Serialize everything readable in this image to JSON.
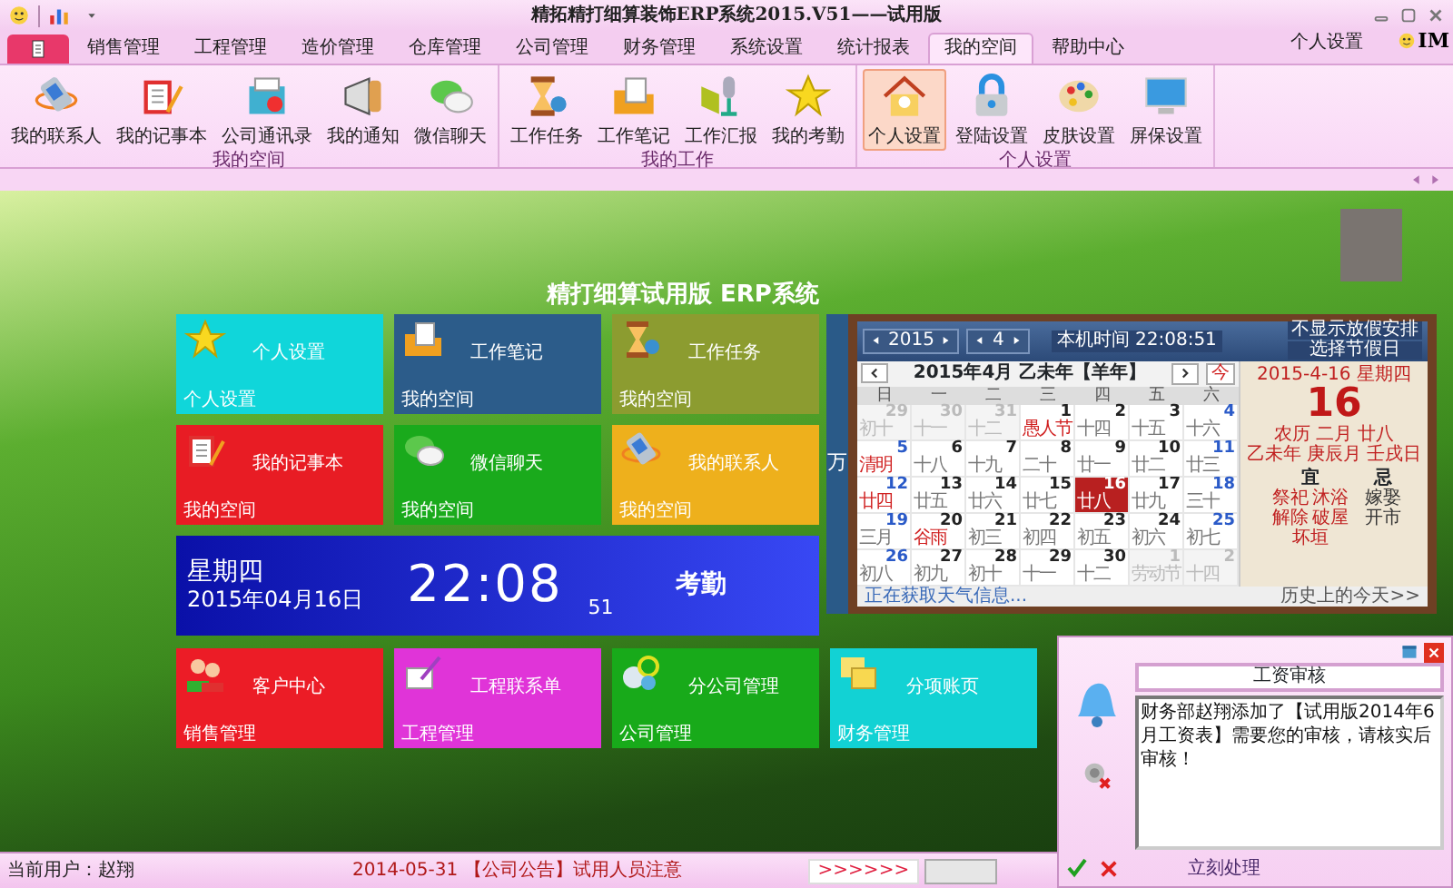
{
  "window": {
    "title": "精拓精打细算装饰ERP系统2015.V51——试用版"
  },
  "ribbon_tabs": [
    {
      "label": "销售管理",
      "selected": false
    },
    {
      "label": "工程管理",
      "selected": false
    },
    {
      "label": "造价管理",
      "selected": false
    },
    {
      "label": "仓库管理",
      "selected": false
    },
    {
      "label": "公司管理",
      "selected": false
    },
    {
      "label": "财务管理",
      "selected": false
    },
    {
      "label": "系统设置",
      "selected": false
    },
    {
      "label": "统计报表",
      "selected": false
    },
    {
      "label": "我的空间",
      "selected": true
    },
    {
      "label": "帮助中心",
      "selected": false
    }
  ],
  "ribbon_right": {
    "settings_link": "个人设置",
    "im_button": "IM"
  },
  "ribbon_groups": [
    {
      "label": "我的空间",
      "buttons": [
        {
          "label": "我的联系人",
          "selected": false
        },
        {
          "label": "我的记事本",
          "selected": false
        },
        {
          "label": "公司通讯录",
          "selected": false
        },
        {
          "label": "我的通知",
          "selected": false
        },
        {
          "label": "微信聊天",
          "selected": false
        }
      ]
    },
    {
      "label": "我的工作",
      "buttons": [
        {
          "label": "工作任务",
          "selected": false
        },
        {
          "label": "工作笔记",
          "selected": false
        },
        {
          "label": "工作汇报",
          "selected": false
        },
        {
          "label": "我的考勤",
          "selected": false
        }
      ]
    },
    {
      "label": "个人设置",
      "buttons": [
        {
          "label": "个人设置",
          "selected": true
        },
        {
          "label": "登陆设置",
          "selected": false
        },
        {
          "label": "皮肤设置",
          "selected": false
        },
        {
          "label": "屏保设置",
          "selected": false
        }
      ]
    }
  ],
  "banner_title": "精打细算试用版 ERP系统",
  "tiles_top": [
    {
      "title": "个人设置",
      "category": "个人设置",
      "color": "#10d6da"
    },
    {
      "title": "工作笔记",
      "category": "我的空间",
      "color": "#2c5c8a"
    },
    {
      "title": "工作任务",
      "category": "我的空间",
      "color": "#8c9c30"
    },
    {
      "title": "我的记事本",
      "category": "我的空间",
      "color": "#e81c24"
    },
    {
      "title": "微信聊天",
      "category": "我的空间",
      "color": "#1aaa1c"
    },
    {
      "title": "我的联系人",
      "category": "我的空间",
      "color": "#eeb01c"
    }
  ],
  "clock_tile": {
    "weekday": "星期四",
    "date": "2015年04月16日",
    "time": "22:08",
    "seconds": "51",
    "label": "考勤"
  },
  "calendar": {
    "side_text": "万",
    "year": "2015",
    "month": "4",
    "local_time": "本机时间 22:08:51",
    "holiday_button": "不显示放假安排",
    "holiday_select": "选择节假日",
    "heading": "2015年4月 乙未年【羊年】",
    "today_button": "今",
    "weekdays": [
      "日",
      "一",
      "二",
      "三",
      "四",
      "五",
      "六"
    ],
    "days": [
      {
        "day": "29",
        "lunar": "初十",
        "other_month": true,
        "festival": false,
        "selected": false
      },
      {
        "day": "30",
        "lunar": "十一",
        "other_month": true,
        "festival": false,
        "selected": false
      },
      {
        "day": "31",
        "lunar": "十二",
        "other_month": true,
        "festival": false,
        "selected": false
      },
      {
        "day": "1",
        "lunar": "愚人节",
        "other_month": false,
        "festival": true,
        "selected": false
      },
      {
        "day": "2",
        "lunar": "十四",
        "other_month": false,
        "festival": false,
        "selected": false
      },
      {
        "day": "3",
        "lunar": "十五",
        "other_month": false,
        "festival": false,
        "selected": false
      },
      {
        "day": "4",
        "lunar": "十六",
        "other_month": false,
        "festival": false,
        "selected": false
      },
      {
        "day": "5",
        "lunar": "清明",
        "other_month": false,
        "festival": true,
        "selected": false
      },
      {
        "day": "6",
        "lunar": "十八",
        "other_month": false,
        "festival": false,
        "selected": false
      },
      {
        "day": "7",
        "lunar": "十九",
        "other_month": false,
        "festival": false,
        "selected": false
      },
      {
        "day": "8",
        "lunar": "二十",
        "other_month": false,
        "festival": false,
        "selected": false
      },
      {
        "day": "9",
        "lunar": "廿一",
        "other_month": false,
        "festival": false,
        "selected": false
      },
      {
        "day": "10",
        "lunar": "廿二",
        "other_month": false,
        "festival": false,
        "selected": false
      },
      {
        "day": "11",
        "lunar": "廿三",
        "other_month": false,
        "festival": false,
        "selected": false
      },
      {
        "day": "12",
        "lunar": "廿四",
        "other_month": false,
        "festival": true,
        "selected": false
      },
      {
        "day": "13",
        "lunar": "廿五",
        "other_month": false,
        "festival": false,
        "selected": false
      },
      {
        "day": "14",
        "lunar": "廿六",
        "other_month": false,
        "festival": false,
        "selected": false
      },
      {
        "day": "15",
        "lunar": "廿七",
        "other_month": false,
        "festival": false,
        "selected": false
      },
      {
        "day": "16",
        "lunar": "廿八",
        "other_month": false,
        "festival": false,
        "selected": true
      },
      {
        "day": "17",
        "lunar": "廿九",
        "other_month": false,
        "festival": false,
        "selected": false
      },
      {
        "day": "18",
        "lunar": "三十",
        "other_month": false,
        "festival": false,
        "selected": false
      },
      {
        "day": "19",
        "lunar": "三月",
        "other_month": false,
        "festival": false,
        "selected": false
      },
      {
        "day": "20",
        "lunar": "谷雨",
        "other_month": false,
        "festival": true,
        "selected": false
      },
      {
        "day": "21",
        "lunar": "初三",
        "other_month": false,
        "festival": false,
        "selected": false
      },
      {
        "day": "22",
        "lunar": "初四",
        "other_month": false,
        "festival": false,
        "selected": false
      },
      {
        "day": "23",
        "lunar": "初五",
        "other_month": false,
        "festival": false,
        "selected": false
      },
      {
        "day": "24",
        "lunar": "初六",
        "other_month": false,
        "festival": false,
        "selected": false
      },
      {
        "day": "25",
        "lunar": "初七",
        "other_month": false,
        "festival": false,
        "selected": false
      },
      {
        "day": "26",
        "lunar": "初八",
        "other_month": false,
        "festival": false,
        "selected": false
      },
      {
        "day": "27",
        "lunar": "初九",
        "other_month": false,
        "festival": false,
        "selected": false
      },
      {
        "day": "28",
        "lunar": "初十",
        "other_month": false,
        "festival": false,
        "selected": false
      },
      {
        "day": "29",
        "lunar": "十一",
        "other_month": false,
        "festival": false,
        "selected": false
      },
      {
        "day": "30",
        "lunar": "十二",
        "other_month": false,
        "festival": false,
        "selected": false
      },
      {
        "day": "1",
        "lunar": "劳动节",
        "other_month": true,
        "festival": false,
        "selected": false
      },
      {
        "day": "2",
        "lunar": "十四",
        "other_month": true,
        "festival": false,
        "selected": false
      }
    ],
    "weather": "正在获取天气信息...",
    "history_link": "历史上的今天>>",
    "almanac": {
      "date": "2015-4-16 星期四",
      "day": "16",
      "lunar": "农历 二月 廿八",
      "ganzhi": "乙未年 庚辰月 壬戌日",
      "good_label": "宜",
      "good": [
        "祭祀",
        "沐浴",
        "解除",
        "破屋",
        "坏垣"
      ],
      "bad_label": "忌",
      "bad": [
        "嫁娶",
        "开市"
      ]
    }
  },
  "tiles_bottom": [
    {
      "title": "客户中心",
      "category": "销售管理",
      "color": "#ec1c26"
    },
    {
      "title": "工程联系单",
      "category": "工程管理",
      "color": "#e034d8"
    },
    {
      "title": "分公司管理",
      "category": "公司管理",
      "color": "#18aa1a"
    },
    {
      "title": "分项账页",
      "category": "财务管理",
      "color": "#12d2d4"
    }
  ],
  "status_bar": {
    "user": "当前用户：赵翔",
    "notice": "2014-05-31 【公司公告】试用人员注意",
    "arrows": ">>>>>>"
  },
  "notification": {
    "title": "工资审核",
    "message": "财务部赵翔添加了【试用版2014年6月工资表】需要您的审核，请核实后审核！",
    "action": "立刻处理"
  }
}
